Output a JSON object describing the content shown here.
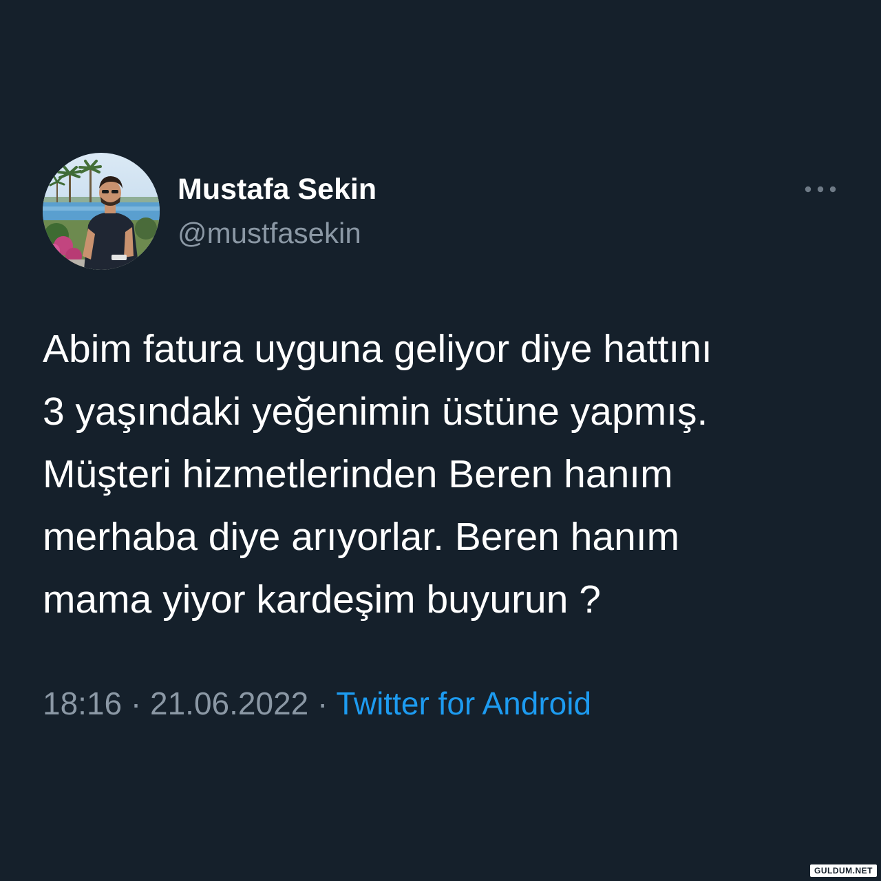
{
  "tweet": {
    "author": {
      "display_name": "Mustafa Sekin",
      "handle": "@mustfasekin"
    },
    "more_icon": "more-options-icon",
    "body_lines": [
      "Abim fatura uyguna geliyor diye hattını",
      "3 yaşındaki yeğenimin üstüne yapmış.",
      "Müşteri hizmetlerinden Beren hanım",
      "merhaba diye arıyorlar. Beren hanım",
      "mama yiyor kardeşim buyurun ?"
    ],
    "meta": {
      "time": "18:16",
      "separator": "·",
      "date": "21.06.2022",
      "source": "Twitter for Android"
    }
  },
  "watermark": "GULDUM.NET",
  "colors": {
    "background": "#15202b",
    "text": "#ffffff",
    "muted": "#8b98a5",
    "link": "#1d9bf0"
  }
}
